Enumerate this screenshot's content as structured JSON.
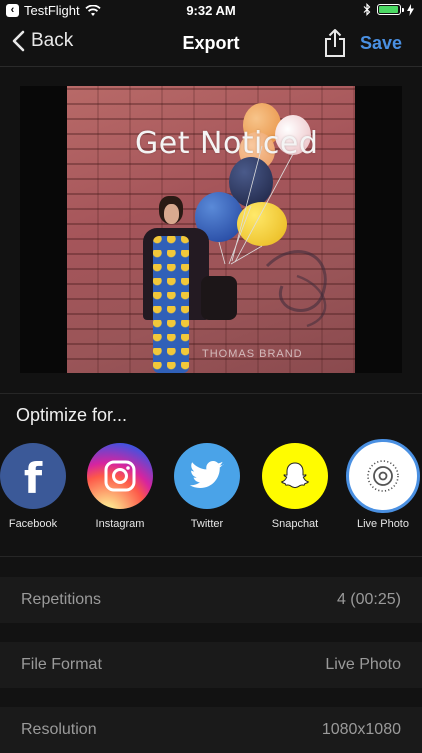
{
  "status_bar": {
    "back_app": "TestFlight",
    "time": "9:32 AM",
    "battery_level": 0.85,
    "battery_color": "#4cd964"
  },
  "nav": {
    "back_label": "Back",
    "title": "Export",
    "share_icon": "share-icon",
    "save_label": "Save",
    "accent": "#4a90e2"
  },
  "preview": {
    "caption": "Get Noticed",
    "watermark": "THOMAS BRAND"
  },
  "optimize": {
    "heading": "Optimize for...",
    "targets": [
      {
        "label": "Facebook",
        "icon": "facebook-icon",
        "color": "#3b5998",
        "selected": false
      },
      {
        "label": "Instagram",
        "icon": "instagram-icon",
        "color": "#d6249f",
        "selected": false
      },
      {
        "label": "Twitter",
        "icon": "twitter-icon",
        "color": "#4aa3e8",
        "selected": false
      },
      {
        "label": "Snapchat",
        "icon": "snapchat-icon",
        "color": "#fffc00",
        "selected": false
      },
      {
        "label": "Live Photo",
        "icon": "live-photo-icon",
        "color": "#ffffff",
        "selected": true
      }
    ]
  },
  "settings": {
    "rows": [
      {
        "label": "Repetitions",
        "value": "4 (00:25)"
      },
      {
        "label": "File Format",
        "value": "Live Photo"
      },
      {
        "label": "Resolution",
        "value": "1080x1080"
      }
    ]
  }
}
